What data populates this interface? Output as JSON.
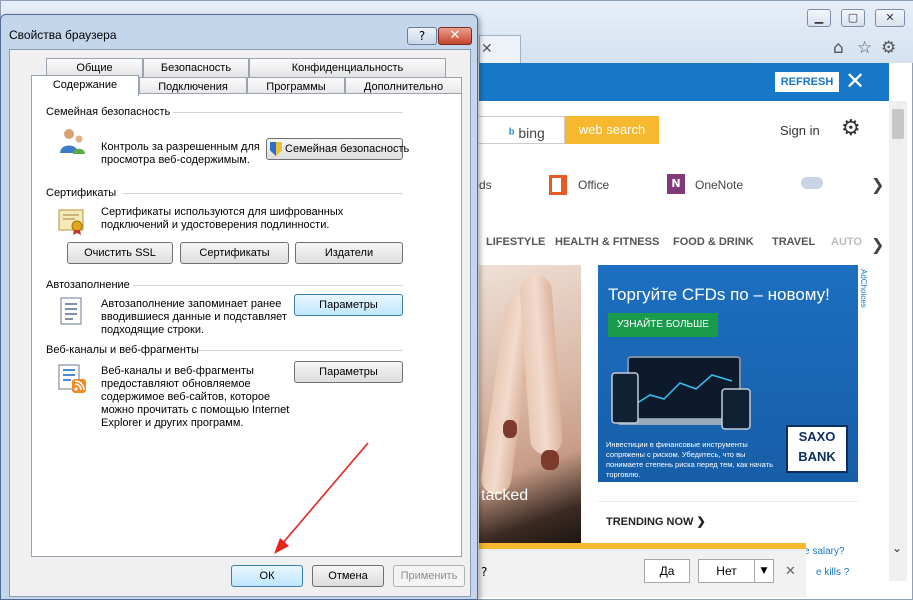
{
  "browser": {
    "refresh_label": "REFRESH",
    "bing_label": "bing",
    "web_search_label": "web search",
    "sign_in_label": "Sign in",
    "apps": [
      "Office",
      "OneNote"
    ],
    "nav_items": [
      "LIFESTYLE",
      "HEALTH & FITNESS",
      "FOOD & DRINK",
      "TRAVEL",
      "AUTO"
    ],
    "photo_caption": "tacked",
    "ad": {
      "title": "Торгуйте CFDs по – новому!",
      "button": "УЗНАЙТЕ БОЛЬШЕ",
      "description": "Инвестиции в финансовые инструменты сопряжены с риском. Убедитесь, что вы понимаете степень риска перед тем, как начать торговлю.",
      "logo_line1": "SAXO",
      "logo_line2": "BANK",
      "adchoices": "AdChoices"
    },
    "trending_title": "TRENDING NOW ❯",
    "trend_1": "e salary?",
    "trend_2": "e kills ?",
    "notification": {
      "question": "?",
      "yes": "Да",
      "no": "Нет"
    }
  },
  "dialog": {
    "title": "Свойства браузера",
    "help": "?",
    "close": "✕",
    "tabs_row1": [
      "Общие",
      "Безопасность",
      "Конфиденциальность"
    ],
    "tabs_row2": [
      "Содержание",
      "Подключения",
      "Программы",
      "Дополнительно"
    ],
    "family": {
      "title": "Семейная безопасность",
      "desc": "Контроль за разрешенным для просмотра веб-содержимым.",
      "button": "Семейная безопасность"
    },
    "certs": {
      "title": "Сертификаты",
      "desc": "Сертификаты используются для шифрованных подключений и удостоверения подлинности.",
      "btn_ssl": "Очистить SSL",
      "btn_certs": "Сертификаты",
      "btn_publishers": "Издатели"
    },
    "autofill": {
      "title": "Автозаполнение",
      "desc": "Автозаполнение запоминает ранее вводившиеся данные и подставляет подходящие строки.",
      "button": "Параметры"
    },
    "feeds": {
      "title": "Веб-каналы и веб-фрагменты",
      "desc": "Веб-каналы и веб-фрагменты предоставляют обновляемое содержимое веб-сайтов, которое можно прочитать с помощью Internet Explorer и других программ.",
      "button": "Параметры"
    },
    "footer": {
      "ok": "ОК",
      "cancel": "Отмена",
      "apply": "Применить"
    }
  },
  "colors": {
    "accent_blue": "#1778c9",
    "search_orange": "#f5b82e",
    "arrow_red": "#e8231e"
  }
}
